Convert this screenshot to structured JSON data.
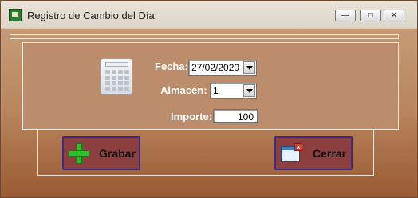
{
  "window": {
    "title": "Registro de Cambio del Día",
    "controls": {
      "minimize": "—",
      "maximize": "□",
      "close": "✕"
    }
  },
  "form": {
    "icon": "calculator-icon",
    "fecha": {
      "label": "Fecha:",
      "value": "27/02/2020"
    },
    "almacen": {
      "label": "Almacén:",
      "value": "1"
    },
    "importe": {
      "label": "Importe:",
      "value": "100"
    }
  },
  "actions": {
    "grabar": {
      "label": "Grabar",
      "icon": "plus-icon"
    },
    "cerrar": {
      "label": "Cerrar",
      "icon": "exit-window-icon"
    }
  },
  "colors": {
    "background": "#b8865f",
    "panel": "#bb8d6d",
    "button": "#8b3f3f",
    "button_border": "#3b2a8c",
    "label_text": "#ffffff"
  }
}
